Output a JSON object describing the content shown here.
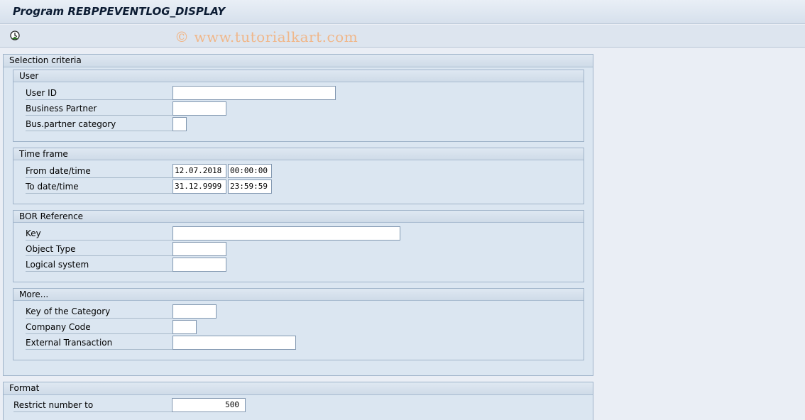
{
  "title": "Program REBPPEVENTLOG_DISPLAY",
  "toolbar": {
    "execute_icon": "execute-clock-icon"
  },
  "watermark": "© www.tutorialkart.com",
  "selection": {
    "header": "Selection criteria",
    "user": {
      "header": "User",
      "user_id": {
        "label": "User ID",
        "value": ""
      },
      "business_partner": {
        "label": "Business Partner",
        "value": ""
      },
      "bp_category": {
        "label": "Bus.partner category",
        "value": ""
      }
    },
    "time_frame": {
      "header": "Time frame",
      "from": {
        "label": "From date/time",
        "date": "12.07.2018",
        "time": "00:00:00"
      },
      "to": {
        "label": "To date/time",
        "date": "31.12.9999",
        "time": "23:59:59"
      }
    },
    "bor": {
      "header": "BOR Reference",
      "key": {
        "label": "Key",
        "value": ""
      },
      "object_type": {
        "label": "Object Type",
        "value": ""
      },
      "logical_system": {
        "label": "Logical system",
        "value": ""
      }
    },
    "more": {
      "header": "More...",
      "category_key": {
        "label": "Key of the Category",
        "value": ""
      },
      "company_code": {
        "label": "Company Code",
        "value": ""
      },
      "external_transaction": {
        "label": "External Transaction",
        "value": ""
      }
    }
  },
  "format": {
    "header": "Format",
    "restrict": {
      "label": "Restrict number to",
      "value": "500"
    }
  }
}
